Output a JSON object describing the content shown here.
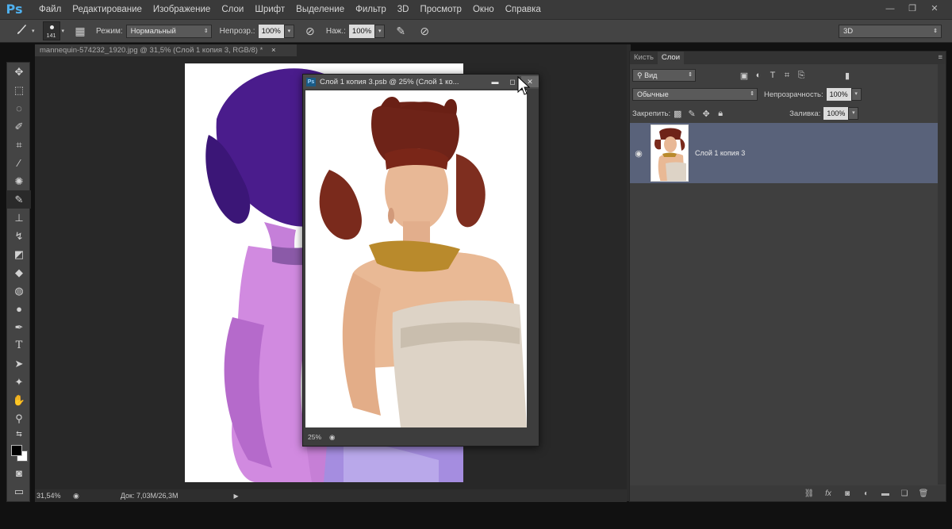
{
  "app": {
    "logo": "Ps",
    "menu": [
      "Файл",
      "Редактирование",
      "Изображение",
      "Слои",
      "Шрифт",
      "Выделение",
      "Фильтр",
      "3D",
      "Просмотр",
      "Окно",
      "Справка"
    ],
    "window_controls": [
      "—",
      "❐",
      "✕"
    ]
  },
  "options": {
    "brush_size": "141",
    "mode_label": "Режим:",
    "mode_value": "Нормальный",
    "opacity_label": "Непрозр.:",
    "opacity_value": "100%",
    "flow_label": "Наж.:",
    "flow_value": "100%",
    "workspace": "3D"
  },
  "document": {
    "tab_title": "mannequin-574232_1920.jpg @ 31,5% (Слой 1 копия 3, RGB/8) *",
    "tab_close": "×"
  },
  "floating_window": {
    "ps_badge": "Ps",
    "title": "Слой 1 копия 3.psb @ 25% (Слой 1 ко...",
    "zoom": "25%"
  },
  "status": {
    "zoom": "31,54%",
    "doc_info": "Док: 7,03М/26,3М",
    "arrow": "▶"
  },
  "layers_panel": {
    "tabs": [
      "Кисть",
      "Слои"
    ],
    "filter_value": "Вид",
    "blend_mode": "Обычные",
    "opacity_label": "Непрозрачность:",
    "opacity_value": "100%",
    "lock_label": "Закрепить:",
    "fill_label": "Заливка:",
    "fill_value": "100%",
    "layer_name": "Слой 1 копия 3"
  },
  "colors": {
    "accent": "#4fb0ee",
    "selected_layer": "#59627a",
    "panel_bg": "#3f3f3f"
  }
}
